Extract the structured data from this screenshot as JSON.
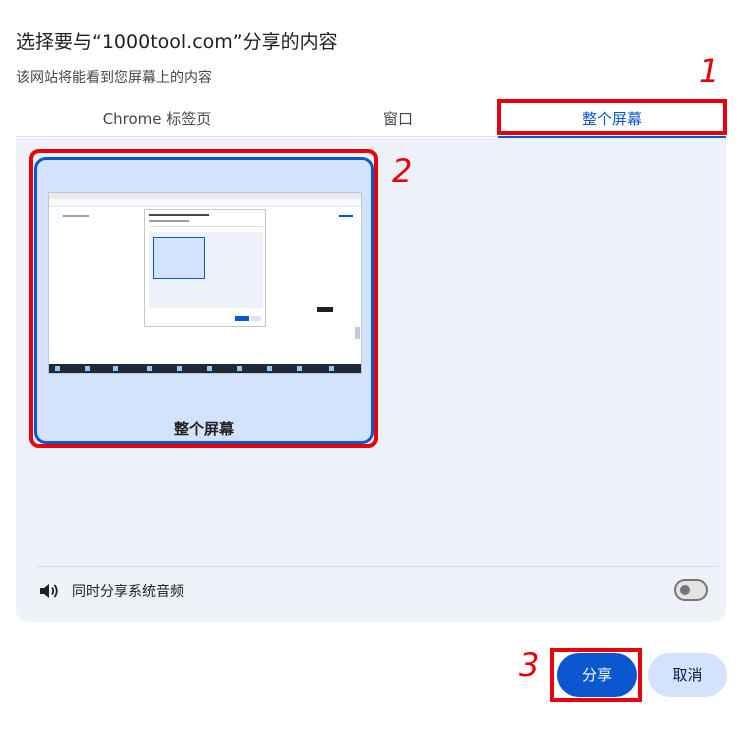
{
  "dialog": {
    "title": "选择要与“1000tool.com”分享的内容",
    "subtitle": "该网站将能看到您屏幕上的内容"
  },
  "tabs": [
    {
      "label": "Chrome 标签页"
    },
    {
      "label": "窗口"
    },
    {
      "label": "整个屏幕",
      "selected": true
    }
  ],
  "screen_tile": {
    "label": "整个屏幕"
  },
  "audio": {
    "label": "同时分享系统音频",
    "enabled": false
  },
  "buttons": {
    "share": "分享",
    "cancel": "取消"
  },
  "annotations": [
    "1",
    "2",
    "3"
  ],
  "colors": {
    "accent": "#0b57d0",
    "panel_bg": "#eef1f8",
    "tile_bg": "#d3e3fd",
    "annotation": "#e8000b"
  },
  "icons": {
    "audio": "speaker-icon"
  }
}
